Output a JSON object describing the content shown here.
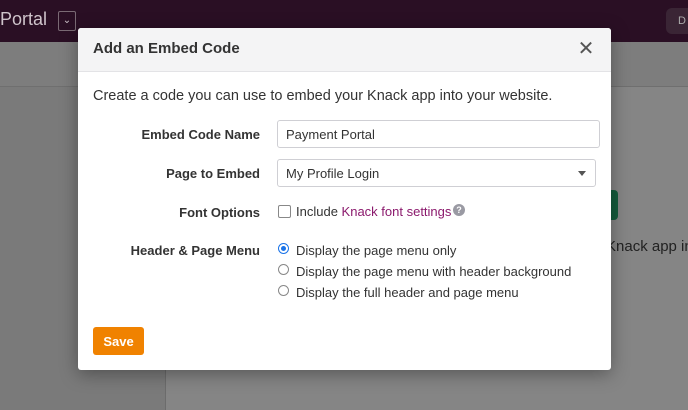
{
  "background": {
    "app_title": "Portal",
    "dropdown_glyph": "⌄",
    "topright_glyph": "D",
    "snippet_text": "Knack app in"
  },
  "modal": {
    "title": "Add an Embed Code",
    "close_glyph": "✕",
    "intro": "Create a code you can use to embed your Knack app into your website.",
    "fields": {
      "embed_name": {
        "label": "Embed Code Name",
        "value": "Payment Portal"
      },
      "page": {
        "label": "Page to Embed",
        "value": "My Profile Login"
      },
      "font": {
        "label": "Font Options",
        "checkbox_text": "Include ",
        "link_text": "Knack font settings",
        "checked": false,
        "help_glyph": "?"
      },
      "header_menu": {
        "label": "Header & Page Menu",
        "options": [
          {
            "label": "Display the page menu only",
            "selected": true
          },
          {
            "label": "Display the page menu with header background",
            "selected": false
          },
          {
            "label": "Display the full header and page menu",
            "selected": false
          }
        ]
      }
    },
    "save_label": "Save"
  },
  "colors": {
    "accent_orange": "#f08200",
    "link_purple": "#8b1a6d",
    "topbar": "#2a0f24"
  },
  "icons": {
    "close": "close-icon",
    "help": "question-circle-icon",
    "select_arrow": "caret-down-icon"
  }
}
